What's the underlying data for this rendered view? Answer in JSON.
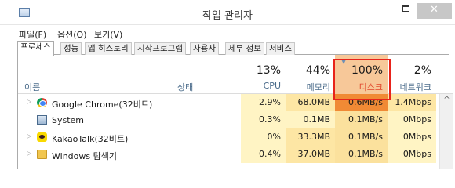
{
  "window": {
    "title": "작업 관리자",
    "min_glyph": "–",
    "close_glyph": "✕"
  },
  "menu": [
    "파일(F)",
    "옵션(O)",
    "보기(V)"
  ],
  "tabs": [
    "프로세스",
    "성능",
    "앱 히스토리",
    "시작프로그램",
    "사용자",
    "세부 정보",
    "서비스"
  ],
  "active_tab": "프로세스",
  "columns": {
    "name": "이름",
    "status": "상태",
    "cpu": {
      "percent": "13%",
      "label": "CPU"
    },
    "memory": {
      "percent": "44%",
      "label": "메모리"
    },
    "disk": {
      "percent": "100%",
      "label": "디스크"
    },
    "network": {
      "percent": "2%",
      "label": "네트워크"
    }
  },
  "processes": [
    {
      "name": "Google Chrome(32비트)",
      "icon": "chrome-icon",
      "expandable": true,
      "cpu": "2.9%",
      "memory": "68.0MB",
      "disk": "0.6MB/s",
      "network": "1.4Mbps"
    },
    {
      "name": "System",
      "icon": "system-icon",
      "expandable": false,
      "cpu": "0.3%",
      "memory": "0.1MB",
      "disk": "0.1MB/s",
      "network": "0Mbps"
    },
    {
      "name": "KakaoTalk(32비트)",
      "icon": "kakaotalk-icon",
      "expandable": true,
      "cpu": "0%",
      "memory": "33.3MB",
      "disk": "0.1MB/s",
      "network": "0Mbps"
    },
    {
      "name": "Windows 탐색기",
      "icon": "folder-icon",
      "expandable": true,
      "cpu": "0.4%",
      "memory": "37.0MB",
      "disk": "0.1MB/s",
      "network": "0Mbps"
    }
  ],
  "colors": {
    "cpu_bg": "#fff4c4",
    "mem_bg": "#fde6a4",
    "disk_bg": "#fbe19d",
    "disk_header_bg": "#f7c899",
    "disk_hot_bg": "#f08a35",
    "net_bg": "#fff4c4",
    "highlight_border": "#e8231b",
    "disk_header_text": "#e0452a"
  }
}
